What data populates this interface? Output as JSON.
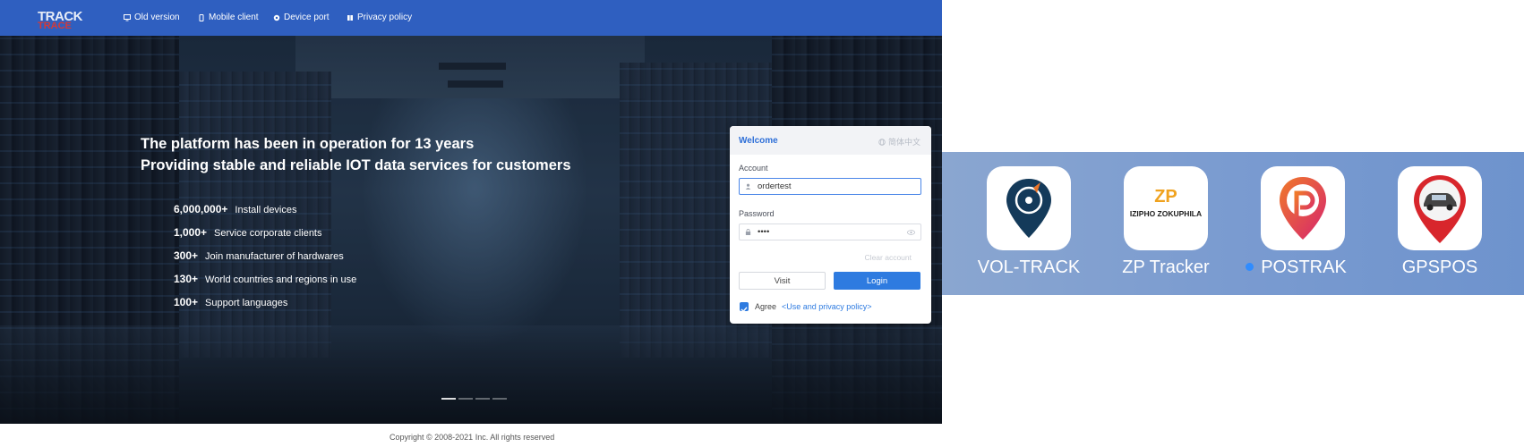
{
  "header": {
    "logo": {
      "line1": "TRACK",
      "line2": "TRACE"
    },
    "nav": [
      {
        "label": "Old version",
        "icon": "monitor-icon"
      },
      {
        "label": "Mobile client",
        "icon": "mobile-icon"
      },
      {
        "label": "Device port",
        "icon": "gear-icon"
      },
      {
        "label": "Privacy policy",
        "icon": "book-icon"
      }
    ]
  },
  "hero": {
    "title_line1": "The platform has been in operation for 13 years",
    "title_line2": "Providing stable and reliable IOT data services for customers",
    "stats": [
      {
        "value": "6,000,000+",
        "label": "Install devices"
      },
      {
        "value": "1,000+",
        "label": "Service corporate clients"
      },
      {
        "value": "300+",
        "label": "Join manufacturer of hardwares"
      },
      {
        "value": "130+",
        "label": "World countries and regions in use"
      },
      {
        "value": "100+",
        "label": "Support languages"
      }
    ]
  },
  "login": {
    "welcome": "Welcome",
    "language": "简体中文",
    "account_label": "Account",
    "account_value": "ordertest",
    "password_label": "Password",
    "password_value": "••••",
    "clear_account": "Clear account",
    "visit": "Visit",
    "login": "Login",
    "agree": "Agree",
    "policy_link": "<Use and privacy policy>"
  },
  "footer": {
    "copyright": "Copyright © 2008-2021 Inc. All rights reserved"
  },
  "apps": [
    {
      "name": "VOL-TRACK",
      "icon": "map-pin-compass-icon"
    },
    {
      "name": "ZP Tracker",
      "icon": "zp-logo-icon",
      "logo_top": "ZP",
      "logo_bottom": "IZIPHO ZOKUPHILA"
    },
    {
      "name": "POSTRAK",
      "icon": "p-pin-icon",
      "new": true
    },
    {
      "name": "GPSPOS",
      "icon": "car-pin-icon"
    }
  ],
  "colors": {
    "header_blue": "#2f5fc0",
    "accent_blue": "#2e7be0",
    "strip_blue": "#7a9bd0"
  }
}
